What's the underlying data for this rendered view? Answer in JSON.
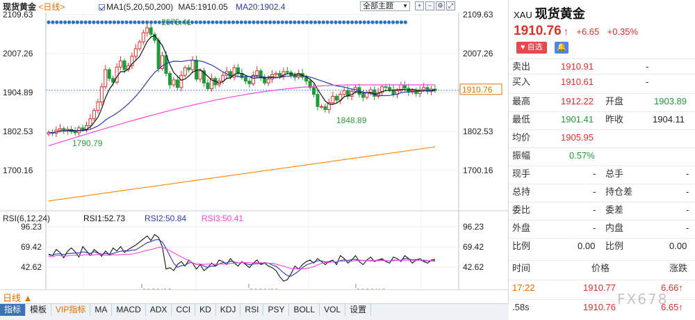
{
  "header": {
    "instrument": "现货黄金",
    "period": "<日线>",
    "ma1": "MA1(5,20,50,200)",
    "ma5": "MA5:1910.05",
    "ma20": "MA20:1902.4",
    "theme": "全部主题"
  },
  "main_chart": {
    "price_axis_ticks": [
      "2109.63",
      "2007.26",
      "1904.89",
      "1802.53",
      "1700.16"
    ],
    "current_price_tag": "1910.76",
    "peak_label": "2075.41",
    "low_label_1": "1790.79",
    "low_label_2": "1848.89"
  },
  "rsi": {
    "label": "RSI(6,12,24)",
    "rsi1": "RSI1:52.73",
    "rsi2": "RSI2:50.84",
    "rsi3": "RSI3:50.41",
    "ticks": [
      "96.23",
      "69.42",
      "42.62"
    ]
  },
  "date_axis": [
    "2020/08",
    "2020/09",
    "2020/10"
  ],
  "period_bar": {
    "label": "日线 ▲"
  },
  "indicators": [
    "指标",
    "模板",
    "VIP指标",
    "MA",
    "MACD",
    "ADX",
    "CCI",
    "KD",
    "KDJ",
    "RSI",
    "PSY",
    "BOLL",
    "VOL",
    "设置"
  ],
  "colors": {
    "up": "#d9312b",
    "down": "#1e9a3a",
    "ma_black": "#111111",
    "ma_blue": "#2a3ba8",
    "ma_magenta": "#ff44dd",
    "ma_orange": "#ff8c1a"
  },
  "side": {
    "code": "XAU",
    "name": "现货黄金",
    "price": "1910.76",
    "arrow": "↑",
    "change": "+6.65",
    "change_pct": "+0.35%",
    "watch_button": "自选",
    "bell_icon": "bell-icon",
    "sell_label": "卖出",
    "sell_value": "1910.91",
    "sell_dash": "-",
    "buy_label": "买入",
    "buy_value": "1910.61",
    "buy_dash": "-",
    "high_label": "最高",
    "high_value": "1912.22",
    "open_label": "开盘",
    "open_value": "1903.89",
    "low_label": "最低",
    "low_value": "1901.41",
    "prev_label": "昨收",
    "prev_value": "1904.11",
    "avg_label": "均价",
    "avg_value": "1905.95",
    "amp_label": "振幅",
    "amp_value": "0.57%",
    "cur_vol_label": "现手",
    "cur_vol_value": "-",
    "total_vol_label": "总手",
    "total_vol_value": "-",
    "hold_label": "总持",
    "hold_value": "-",
    "hold_diff_label": "持仓差",
    "hold_diff_value": "-",
    "ratio_label": "委比",
    "ratio_value": "-",
    "diff_label": "委差",
    "diff_value": "-",
    "outer_label": "外盘",
    "outer_value": "-",
    "inner_label": "内盘",
    "inner_value": "-",
    "pr1_label": "比例",
    "pr1_value": "0.00",
    "pr2_label": "比例",
    "pr2_value": "0.00",
    "ticks_head": {
      "time": "时间",
      "price": "价格",
      "change": "涨跌"
    },
    "ticks": [
      {
        "time": "17:22",
        "price": "1910.77",
        "change": "6.66↑"
      },
      {
        "time": ".58s",
        "price": "1910.76",
        "change": "6.65↑"
      }
    ],
    "watermark": "FX678"
  }
}
